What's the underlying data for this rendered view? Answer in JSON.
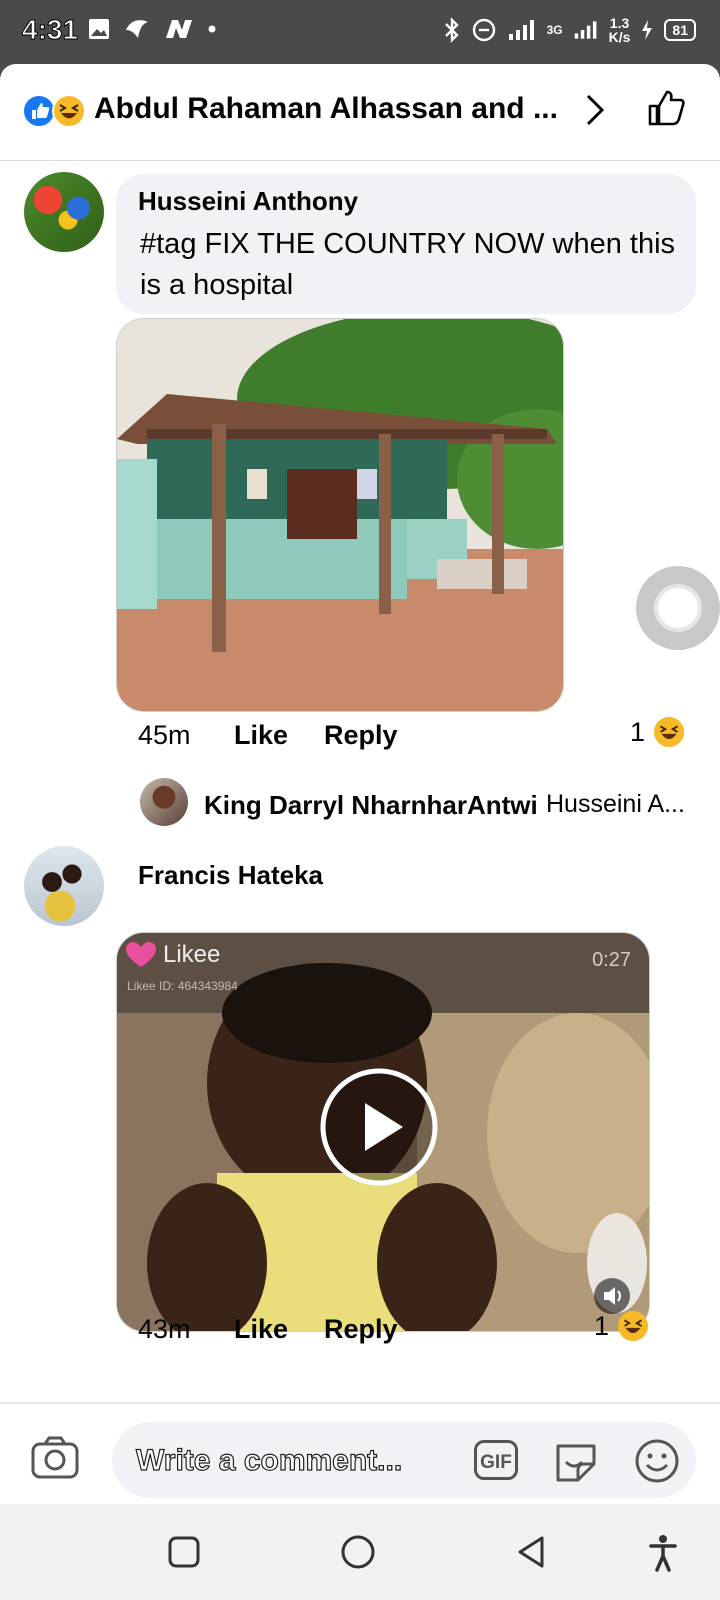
{
  "status_bar": {
    "time": "4:31",
    "speed": "1.3",
    "speed_unit": "K/s",
    "battery": "81",
    "network": "3G"
  },
  "header": {
    "title": "Abdul Rahaman Alhassan and ..."
  },
  "comments": [
    {
      "name": "Husseini Anthony",
      "text": "#tag FIX THE COUNTRY NOW when this is a hospital",
      "time": "45m",
      "like": "Like",
      "reply": "Reply",
      "reactions": "1"
    },
    {
      "name": "Francis Hateka",
      "text": "",
      "time": "43m",
      "like": "Like",
      "reply": "Reply",
      "reactions": "1"
    }
  ],
  "reply_preview": {
    "name": "King Darryl NharnharAntwi",
    "text": "Husseini A..."
  },
  "video": {
    "brand": "Likee",
    "id_text": "Likee ID: 464343984",
    "duration": "0:27"
  },
  "composer": {
    "placeholder": "Write a comment...",
    "gif": "GIF"
  },
  "icons": [
    "image-icon",
    "bird-icon",
    "n-icon",
    "bluetooth-icon",
    "dnd-icon",
    "signal-icon",
    "battery-icon",
    "like-icon",
    "haha-icon",
    "chevron-right-icon",
    "thumbs-up-icon",
    "camera-icon",
    "gif-icon",
    "sticker-icon",
    "emoji-icon",
    "play-icon",
    "volume-icon",
    "square-icon",
    "circle-icon",
    "back-icon",
    "accessibility-icon"
  ]
}
